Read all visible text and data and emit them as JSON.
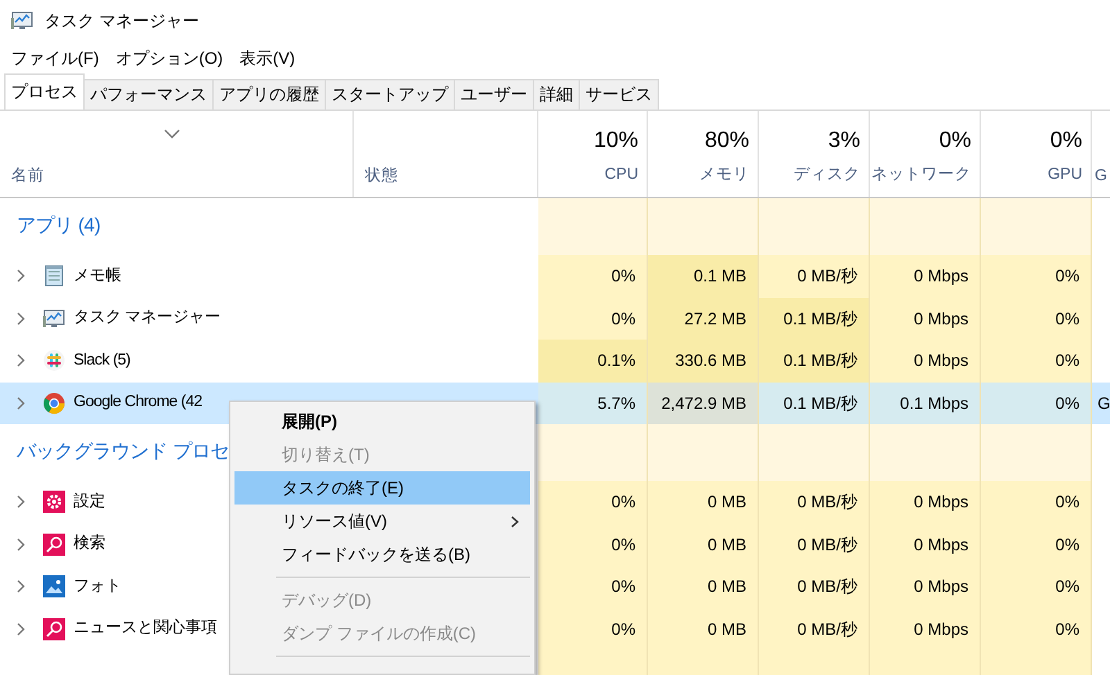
{
  "window": {
    "title": "タスク マネージャー"
  },
  "menu": [
    "ファイル(F)",
    "オプション(O)",
    "表示(V)"
  ],
  "tabs": [
    {
      "label": "プロセス",
      "selected": true
    },
    {
      "label": "パフォーマンス",
      "selected": false
    },
    {
      "label": "アプリの履歴",
      "selected": false
    },
    {
      "label": "スタートアップ",
      "selected": false
    },
    {
      "label": "ユーザー",
      "selected": false
    },
    {
      "label": "詳細",
      "selected": false
    },
    {
      "label": "サービス",
      "selected": false
    }
  ],
  "columns": [
    {
      "label": "名前",
      "sorted": true
    },
    {
      "label": "状態",
      "sorted": false
    },
    {
      "summary": "10%",
      "label": "CPU",
      "sorted": false
    },
    {
      "summary": "80%",
      "label": "メモリ",
      "sorted": false
    },
    {
      "summary": "3%",
      "label": "ディスク",
      "sorted": false
    },
    {
      "summary": "0%",
      "label": "ネットワーク",
      "sorted": false
    },
    {
      "summary": "0%",
      "label": "GPU",
      "sorted": false
    },
    {
      "label": "G",
      "sorted": false
    }
  ],
  "groups": [
    {
      "title": "アプリ (4)",
      "rows": [
        {
          "name": "メモ帳",
          "expanded": false,
          "selected": false,
          "cells": [
            {
              "text": "0%",
              "high": false
            },
            {
              "text": "0.1 MB",
              "high": true
            },
            {
              "text": "0 MB/秒",
              "high": false
            },
            {
              "text": "0 Mbps",
              "high": false
            },
            {
              "text": "0%",
              "high": false
            }
          ]
        },
        {
          "name": "タスク マネージャー",
          "expanded": false,
          "selected": false,
          "cells": [
            {
              "text": "0%",
              "high": false
            },
            {
              "text": "27.2 MB",
              "high": true
            },
            {
              "text": "0.1 MB/秒",
              "high": true
            },
            {
              "text": "0 Mbps",
              "high": false
            },
            {
              "text": "0%",
              "high": false
            }
          ]
        },
        {
          "name": "Slack (5)",
          "expanded": false,
          "selected": false,
          "cells": [
            {
              "text": "0.1%",
              "high": true
            },
            {
              "text": "330.6 MB",
              "high": true
            },
            {
              "text": "0.1 MB/秒",
              "high": true
            },
            {
              "text": "0 Mbps",
              "high": false
            },
            {
              "text": "0%",
              "high": false
            }
          ]
        },
        {
          "name": "Google Chrome (42",
          "expanded": false,
          "selected": true,
          "cells": [
            {
              "text": "5.7%",
              "high": false
            },
            {
              "text": "2,472.9 MB",
              "high": true
            },
            {
              "text": "0.1 MB/秒",
              "high": false
            },
            {
              "text": "0.1 Mbps",
              "high": false
            },
            {
              "text": "0%",
              "high": false
            }
          ],
          "column_8": "G"
        }
      ]
    },
    {
      "title": "バックグラウンド プロセ",
      "rows": [
        {
          "name": "設定",
          "expanded": false,
          "selected": false,
          "cells": [
            {
              "text": "0%",
              "high": false
            },
            {
              "text": "0 MB",
              "high": false
            },
            {
              "text": "0 MB/秒",
              "high": false
            },
            {
              "text": "0 Mbps",
              "high": false
            },
            {
              "text": "0%",
              "high": false
            }
          ]
        },
        {
          "name": "検索",
          "expanded": false,
          "selected": false,
          "cells": [
            {
              "text": "0%",
              "high": false
            },
            {
              "text": "0 MB",
              "high": false
            },
            {
              "text": "0 MB/秒",
              "high": false
            },
            {
              "text": "0 Mbps",
              "high": false
            },
            {
              "text": "0%",
              "high": false
            }
          ]
        },
        {
          "name": "フォト",
          "expanded": false,
          "selected": false,
          "cells": [
            {
              "text": "0%",
              "high": false
            },
            {
              "text": "0 MB",
              "high": false
            },
            {
              "text": "0 MB/秒",
              "high": false
            },
            {
              "text": "0 Mbps",
              "high": false
            },
            {
              "text": "0%",
              "high": false
            }
          ]
        },
        {
          "name": "ニュースと関心事項",
          "expanded": false,
          "selected": false,
          "cells": [
            {
              "text": "0%",
              "high": false
            },
            {
              "text": "0 MB",
              "high": false
            },
            {
              "text": "0 MB/秒",
              "high": false
            },
            {
              "text": "0 Mbps",
              "high": false
            },
            {
              "text": "0%",
              "high": false
            }
          ]
        }
      ]
    }
  ],
  "context_menu": {
    "items": [
      {
        "kind": "item",
        "label": "展開(P)",
        "default": true,
        "disabled": false,
        "selected": false,
        "submenu": false
      },
      {
        "kind": "item",
        "label": "切り替え(T)",
        "default": false,
        "disabled": true,
        "selected": false,
        "submenu": false
      },
      {
        "kind": "item",
        "label": "タスクの終了(E)",
        "default": false,
        "disabled": false,
        "selected": true,
        "submenu": false
      },
      {
        "kind": "item",
        "label": "リソース値(V)",
        "default": false,
        "disabled": false,
        "selected": false,
        "submenu": true
      },
      {
        "kind": "item",
        "label": "フィードバックを送る(B)",
        "default": false,
        "disabled": false,
        "selected": false,
        "submenu": false
      },
      {
        "kind": "separator"
      },
      {
        "kind": "item",
        "label": "デバッグ(D)",
        "default": false,
        "disabled": true,
        "selected": false,
        "submenu": false
      },
      {
        "kind": "item",
        "label": "ダンプ ファイルの作成(C)",
        "default": false,
        "disabled": true,
        "selected": false,
        "submenu": false
      },
      {
        "kind": "separator"
      }
    ]
  }
}
